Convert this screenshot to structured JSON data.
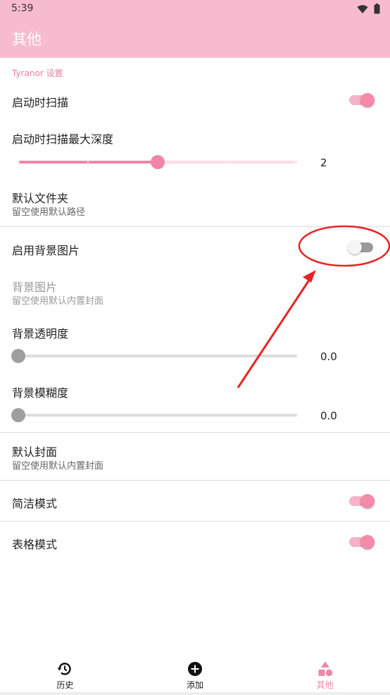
{
  "status": {
    "time": "5:39"
  },
  "app_bar": {
    "title": "其他"
  },
  "section": {
    "header": "Tyranor 设置"
  },
  "settings": {
    "scan_on_start": {
      "title": "启动时扫描",
      "on": true
    },
    "scan_depth": {
      "title": "启动时扫描最大深度",
      "value": "2",
      "level": 0.5,
      "ticks": 4
    },
    "default_folder": {
      "title": "默认文件夹",
      "subtitle": "留空使用默认路径"
    },
    "bg_enable": {
      "title": "启用背景图片",
      "on": false
    },
    "bg_image": {
      "title": "背景图片",
      "subtitle": "留空使用默认内置封面",
      "enabled": false
    },
    "bg_opacity": {
      "title": "背景透明度",
      "value": "0.0",
      "level": 0
    },
    "bg_blur": {
      "title": "背景模糊度",
      "value": "0.0",
      "level": 0
    },
    "default_cover": {
      "title": "默认封面",
      "subtitle": "留空使用默认内置封面"
    },
    "simple_mode": {
      "title": "简洁模式",
      "on": true
    },
    "table_mode": {
      "title": "表格模式",
      "on": true
    }
  },
  "bottom_nav": {
    "items": [
      {
        "label": "历史",
        "icon": "history-icon",
        "active": false
      },
      {
        "label": "添加",
        "icon": "add-circle-icon",
        "active": false
      },
      {
        "label": "其他",
        "icon": "shapes-icon",
        "active": true
      }
    ]
  },
  "colors": {
    "accent": "#ef86aa",
    "app_bar": "#f7bbd0",
    "annotation": "#e82424"
  }
}
